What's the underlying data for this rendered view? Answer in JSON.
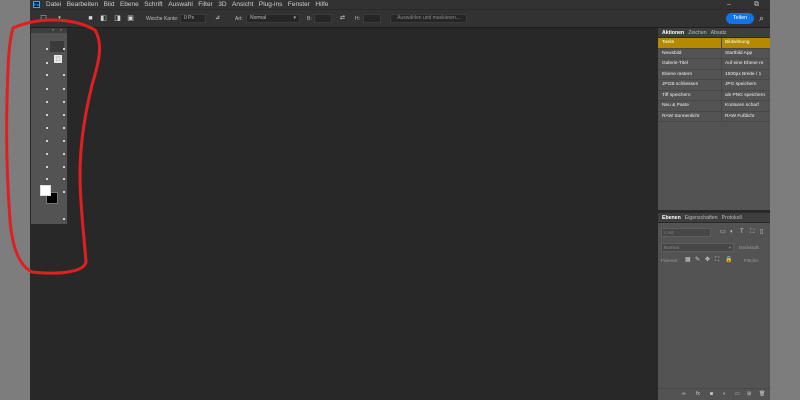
{
  "app": {
    "logo": "Ps"
  },
  "menu": [
    "Datei",
    "Bearbeiten",
    "Bild",
    "Ebene",
    "Schrift",
    "Auswahl",
    "Filter",
    "3D",
    "Ansicht",
    "Plug-ins",
    "Fenster",
    "Hilfe"
  ],
  "window_controls": {
    "minimize": "–",
    "restore": "⧉"
  },
  "options": {
    "feather_label": "Weiche Kante:",
    "feather_value": "0 Px",
    "style_label": "Art:",
    "style_value": "Normal",
    "width_label": "B:",
    "height_label": "H:",
    "select_mask_button": "Auswählen und maskieren...",
    "share_button": "Teilen"
  },
  "toolbar": {
    "collapse": "«",
    "close": "×"
  },
  "actions_panel": {
    "tabs": [
      "Aktionen",
      "Zeichen",
      "Absatz"
    ],
    "rows": [
      {
        "left": "Tasks",
        "right": "Bildwirkung",
        "selected": true
      },
      {
        "left": "Newsbild",
        "right": "Startbild App",
        "selected": false
      },
      {
        "left": "Galerie-Titel",
        "right": "Auf eine Ebene re",
        "selected": false
      },
      {
        "left": "Ebene rastern",
        "right": "1500px Breite / 1",
        "selected": false
      },
      {
        "left": "JPGB schliessen",
        "right": "JPG speichern",
        "selected": false
      },
      {
        "left": "Tiff speichern",
        "right": "als PNG speichern",
        "selected": false
      },
      {
        "left": "Neu & Paste",
        "right": "Konturen scharf",
        "selected": false
      },
      {
        "left": "RAW Sonnenlicht",
        "right": "RAW Fußlicht",
        "selected": false
      }
    ]
  },
  "layers_panel": {
    "tabs": [
      "Ebenen",
      "Eigenschaften",
      "Protokoll"
    ],
    "filter_placeholder": "Art",
    "blend_mode": "Normal",
    "opacity_label": "Deckkraft:",
    "lock_label": "Fixieren:",
    "fill_label": "Fläche:"
  },
  "colors": {
    "accent_selected": "#b58a00",
    "share_blue": "#1473e6",
    "annotation_red": "#e02020",
    "foreground": "#ffffff",
    "background": "#000000"
  }
}
